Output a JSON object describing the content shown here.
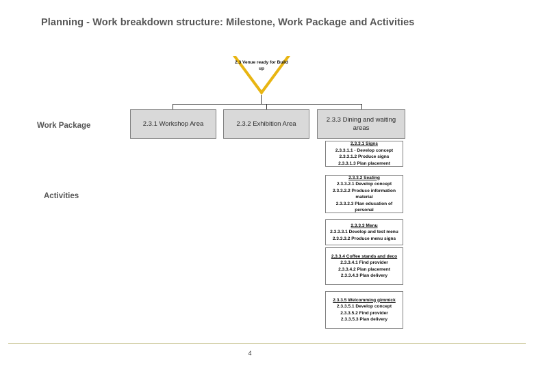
{
  "slide": {
    "title": "Planning - Work breakdown structure: Milestone, Work Package and Activities",
    "page_number": "4",
    "colors": {
      "milestone_border": "#E8B512",
      "work_package_fill": "#D9D9D9",
      "box_border": "#7F7F7F",
      "title_text": "#555555",
      "footer_rule": "#CFCBA1"
    }
  },
  "row_labels": {
    "work_package": "Work Package",
    "activities": "Activities"
  },
  "milestone": {
    "shape": "down-triangle",
    "text": "2.3 Venue ready for Build up"
  },
  "work_packages": [
    {
      "label": "2.3.1 Workshop Area"
    },
    {
      "label": "2.3.2  Exhibition Area"
    },
    {
      "label": "2.3.3 Dining and waiting areas"
    }
  ],
  "activity_groups": [
    {
      "header": "2.3.3.1 Signs",
      "items": [
        "2.3.3.1.1 - Develop concept",
        "2.3.3.1.2 Produce signs",
        "2.3.3.1.3 Plan placement"
      ]
    },
    {
      "header": "2.3.3.2 Seating",
      "items": [
        "2.3.3.2.1 Develop concept",
        "2.3.3.2.2 Produce information material",
        "2.3.3.2.3 Plan education of personal"
      ]
    },
    {
      "header": "2.3.3.3 Menu",
      "items": [
        "2.3.3.3.1 Develop and test menu",
        "2.3.3.3.2 Produce menu signs"
      ]
    },
    {
      "header": "2.3.3.4  Coffee stands and deco",
      "items": [
        "2.3.3.4.1 Find provider",
        "2.3.3.4.2 Plan placement",
        "2.3.3.4.3 Plan delivery"
      ]
    },
    {
      "header": "2.3.3.5 Welcomming gimmick",
      "items": [
        "2.3.3.5.1 Develop concept",
        "2.3.3.5.2 Find provider",
        "2.3.3.5.3 Plan delivery"
      ]
    }
  ]
}
